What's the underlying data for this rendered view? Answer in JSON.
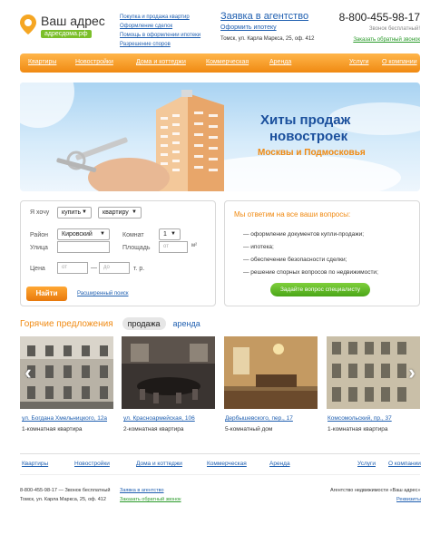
{
  "brand": {
    "title": "Ваш адрес",
    "domain": "адресдома.рф",
    "accent": "#f08a12",
    "green": "#7bbf2a"
  },
  "top_links": [
    "Покупка и продажа квартир",
    "Оформление сделок",
    "Помощь в оформлении ипотеки",
    "Разрешение споров"
  ],
  "request": {
    "title": "Заявка в агентство",
    "subtitle": "Оформить ипотеку",
    "address": "Томск, ул. Карла Маркса, 25, оф. 412"
  },
  "contact": {
    "phone": "8-800-455-98-17",
    "free_note": "Звонок бесплатный!",
    "callback": "Заказать обратный звонок"
  },
  "nav": {
    "items": [
      "Квартиры",
      "Новостройки",
      "Дома и коттеджи",
      "Коммерческая",
      "Аренда"
    ],
    "right": [
      "Услуги",
      "О компании"
    ]
  },
  "banner": {
    "line1": "Хиты продаж",
    "line2": "новостроек",
    "sub": "Москвы и Подмосковья"
  },
  "search": {
    "want_label": "Я хочу",
    "want_value": "купить",
    "type_value": "квартиру",
    "district_label": "Район",
    "district_value": "Кировский",
    "rooms_label": "Комнат",
    "rooms_value": "1",
    "street_label": "Улица",
    "area_label": "Площадь",
    "area_from": "от",
    "area_unit": "м²",
    "price_label": "Цена",
    "price_from": "от",
    "price_dash": "—",
    "price_to": "до",
    "price_unit": "т. р.",
    "find_button": "Найти",
    "advanced": "Расширенный поиск"
  },
  "answers": {
    "title": "Мы ответим на все ваши вопросы:",
    "items": [
      "— оформление документов купли-продажи;",
      "— ипотека;",
      "— обеспечение безопасности сделки;",
      "— решение спорных вопросов по недвижимости;"
    ],
    "button": "Задайте вопрос специалисту"
  },
  "hot": {
    "title": "Горячие предложения",
    "tab_active": "продажа",
    "tab": "аренда"
  },
  "offers": [
    {
      "address": "ул. Богдана Хмельницкого, 12а",
      "type": "1-комнатная квартира"
    },
    {
      "address": "ул. Красноармейская, 106",
      "type": "2-комнатная квартира"
    },
    {
      "address": "Дербышевского, пер., 17",
      "type": "5-комнатный дом"
    },
    {
      "address": "Комсомольский, пр., 37",
      "type": "1-комнатная квартира"
    }
  ],
  "footer": {
    "nav": [
      "Квартиры",
      "Новостройки",
      "Дома и коттеджи",
      "Коммерческая",
      "Аренда"
    ],
    "nav_right": [
      "Услуги",
      "О компании"
    ],
    "phone_line": "8-800-455-98-17 — Звонок бесплатный",
    "address": "Томск, ул. Карла Маркса, 25, оф. 412",
    "request": "Заявка в агентство",
    "callback": "Заказать обратный звонок",
    "agency": "Агентство недвижимости «Ваш адрес»",
    "requisites": "Реквизиты"
  }
}
